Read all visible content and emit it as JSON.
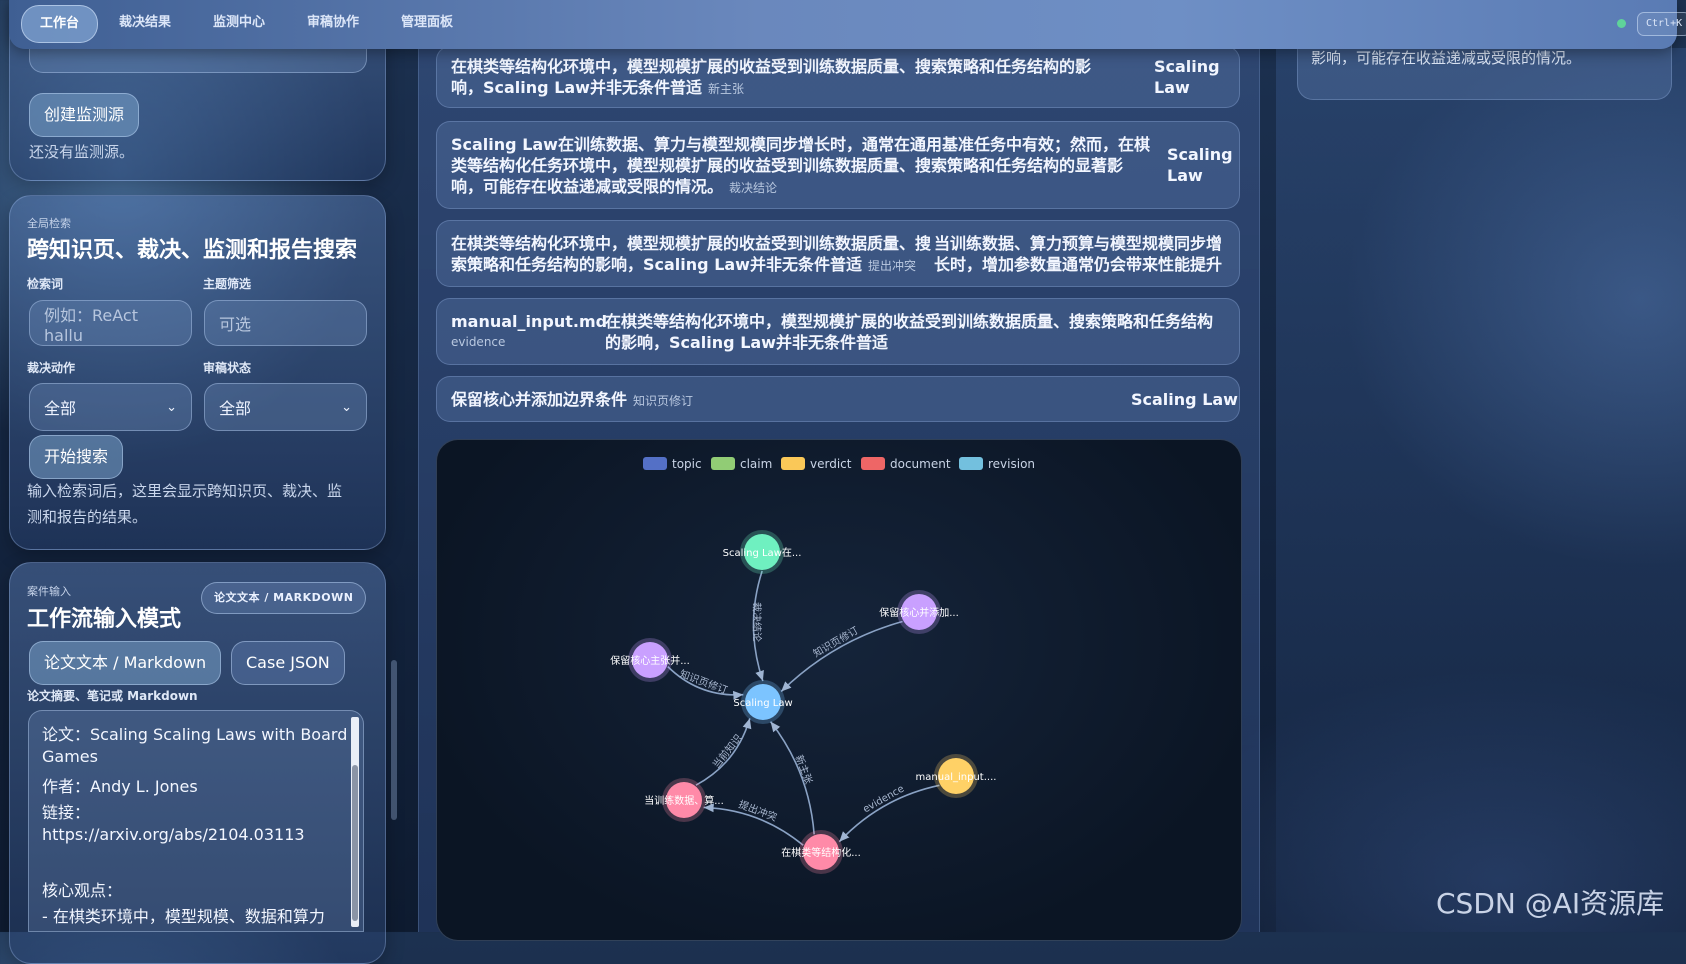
{
  "nav": {
    "tabs": [
      {
        "label": "工作台",
        "active": true
      },
      {
        "label": "裁决结果"
      },
      {
        "label": "监测中心"
      },
      {
        "label": "审稿协作"
      },
      {
        "label": "管理面板"
      }
    ],
    "shortcut": "Ctrl+K"
  },
  "monitor": {
    "create_button": "创建监测源",
    "empty_text": "还没有监测源。"
  },
  "search": {
    "kicker": "全局检索",
    "title": "跨知识页、裁决、监测和报告搜索",
    "query_label": "检索词",
    "query_placeholder": "例如：ReAct hallu",
    "topic_label": "主题筛选",
    "topic_placeholder": "可选",
    "action_label": "裁决动作",
    "action_value": "全部",
    "review_label": "审稿状态",
    "review_value": "全部",
    "start_button": "开始搜索",
    "hint": "输入检索词后，这里会显示跨知识页、裁决、监测和报告的结果。"
  },
  "workflow": {
    "kicker": "案件输入",
    "title": "工作流输入模式",
    "mode_badge": "论文文本 / MARKDOWN",
    "mode_text_button": "论文文本 / Markdown",
    "mode_json_button": "Case JSON",
    "textarea_label": "论文摘要、笔记或 Markdown",
    "textarea_lines": [
      "论文：Scaling Scaling Laws with Board",
      "Games",
      "作者：Andy L. Jones",
      "链接：",
      "https://arxiv.org/abs/2104.03113",
      "",
      "核心观点：",
      "- 在棋类环境中，模型规模、数据和算力"
    ]
  },
  "results": [
    {
      "text": "在棋类等结构化环境中，模型规模扩展的收益受到训练数据质量、搜索策略和任务结构的影响，Scaling Law并非无条件普适",
      "tag": "新主张",
      "side": "Scaling Law"
    },
    {
      "text": "Scaling Law在训练数据、算力与模型规模同步增长时，通常在通用基准任务中有效；然而，在棋类等结构化任务环境中，模型规模扩展的收益受到训练数据质量、搜索策略和任务结构的显著影响，可能存在收益递减或受限的情况。",
      "tag": "裁决结论",
      "side": "Scaling Law"
    },
    {
      "text": "在棋类等结构化环境中，模型规模扩展的收益受到训练数据质量、搜索策略和任务结构的影响，Scaling Law并非无条件普适",
      "tag": "提出冲突",
      "side": "当训练数据、算力预算与模型规模同步增长时，增加参数量通常仍会带来性能提升"
    },
    {
      "source": "manual_input.md",
      "source_tag": "evidence",
      "text": "在棋类等结构化环境中，模型规模扩展的收益受到训练数据质量、搜索策略和任务结构的影响，Scaling Law并非无条件普适"
    },
    {
      "text": "保留核心并添加边界条件",
      "tag": "知识页修订",
      "side": "Scaling Law"
    }
  ],
  "right_panel": {
    "text": "影响，可能存在收益递减或受限的情况。"
  },
  "graph": {
    "legend": [
      {
        "name": "topic",
        "color": "#5470c6"
      },
      {
        "name": "claim",
        "color": "#91cc75"
      },
      {
        "name": "verdict",
        "color": "#fac858"
      },
      {
        "name": "document",
        "color": "#ee6666"
      },
      {
        "name": "revision",
        "color": "#73c0de"
      }
    ],
    "nodes": [
      {
        "id": "center",
        "label": "Scaling Law",
        "color": "#7cc4ff"
      },
      {
        "id": "top",
        "label": "Scaling Law在...",
        "color": "#6ff0c0"
      },
      {
        "id": "right",
        "label": "保留核心并添加...",
        "color": "#c9a0ff"
      },
      {
        "id": "left",
        "label": "保留核心主张并...",
        "color": "#c9a0ff"
      },
      {
        "id": "bl",
        "label": "当训练数据、算...",
        "color": "#ff8aa8"
      },
      {
        "id": "bottom",
        "label": "在棋类等结构化...",
        "color": "#ff8aa8"
      },
      {
        "id": "br",
        "label": "manual_input....",
        "color": "#ffd166"
      }
    ],
    "edges": [
      {
        "from": "top",
        "to": "center",
        "label": "裁决结论"
      },
      {
        "from": "right",
        "to": "center",
        "label": "知识页修订"
      },
      {
        "from": "left",
        "to": "center",
        "label": "知识页修订"
      },
      {
        "from": "bl",
        "to": "center",
        "label": "当前知识"
      },
      {
        "from": "bottom",
        "to": "center",
        "label": "新主张"
      },
      {
        "from": "bottom",
        "to": "bl",
        "label": "提出冲突"
      },
      {
        "from": "br",
        "to": "bottom",
        "label": "evidence"
      }
    ]
  },
  "watermark": "CSDN @AI资源库"
}
